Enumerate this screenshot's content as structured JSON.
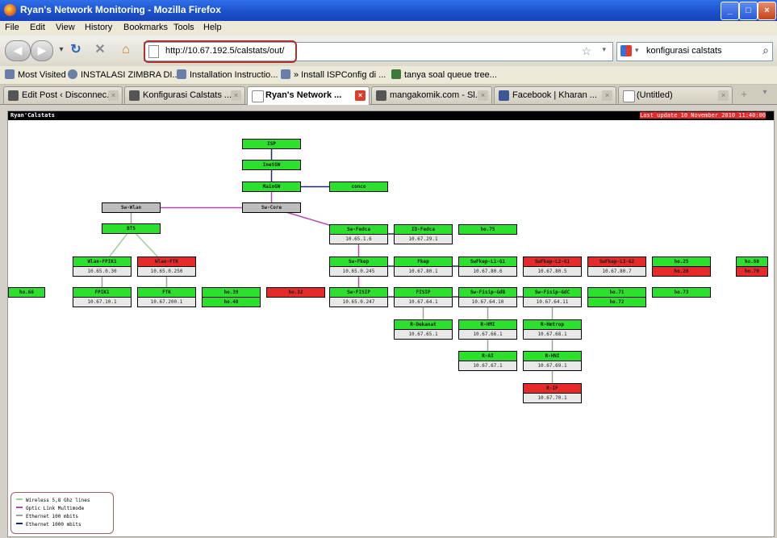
{
  "window": {
    "title": "Ryan's Network Monitoring - Mozilla Firefox"
  },
  "menu": [
    "File",
    "Edit",
    "View",
    "History",
    "Bookmarks",
    "Tools",
    "Help"
  ],
  "address": {
    "url": "http://10.67.192.5/calstats/out/"
  },
  "search": {
    "value": "konfigurasi calstats"
  },
  "bookmarks": [
    "Most Visited",
    "INSTALASI ZIMBRA DI...",
    "Installation Instructio...",
    "» Install ISPConfig di ...",
    "tanya soal queue tree..."
  ],
  "tabs": [
    {
      "label": "Edit Post ‹ Disconnec...",
      "active": false
    },
    {
      "label": "Konfigurasi Calstats ...",
      "active": false
    },
    {
      "label": "Ryan's Network ...",
      "active": true
    },
    {
      "label": "mangakomik.com - Sl...",
      "active": false
    },
    {
      "label": "Facebook | Kharan ...",
      "active": false
    },
    {
      "label": "(Untitled)",
      "active": false
    }
  ],
  "page": {
    "header_left": "Ryan'Calstats",
    "header_right": "Last update 10 November 2010 11:40:00"
  },
  "nodes": [
    {
      "id": "n1",
      "name": "ISP",
      "ip": "",
      "status": "up"
    },
    {
      "id": "n2",
      "name": "InetGW",
      "ip": "",
      "status": "up"
    },
    {
      "id": "n3",
      "name": "MainGW",
      "ip": "",
      "status": "up"
    },
    {
      "id": "n4",
      "name": "conco",
      "ip": "",
      "status": "up"
    },
    {
      "id": "n5",
      "name": "Sw-Wlan",
      "ip": "",
      "status": "switch"
    },
    {
      "id": "n6",
      "name": "Sw-Core",
      "ip": "",
      "status": "switch"
    },
    {
      "id": "n7",
      "name": "BTS",
      "ip": "",
      "status": "up"
    },
    {
      "id": "n8",
      "name": "Sw-Fedca",
      "ip": "10.65.1.6",
      "status": "up"
    },
    {
      "id": "n9",
      "name": "ID-Fedca",
      "ip": "10.67.29.1",
      "status": "up"
    },
    {
      "id": "n10",
      "name": "ho.75",
      "ip": "",
      "status": "up"
    },
    {
      "id": "n11",
      "name": "Wlan-FPIK1",
      "ip": "10.65.0.30",
      "status": "up"
    },
    {
      "id": "n12",
      "name": "Wlan-FTK",
      "ip": "10.65.0.250",
      "status": "down"
    },
    {
      "id": "n13",
      "name": "Sw-Fkep",
      "ip": "10.65.0.245",
      "status": "up"
    },
    {
      "id": "n14",
      "name": "Fkep",
      "ip": "10.67.80.1",
      "status": "up"
    },
    {
      "id": "n15",
      "name": "SwFkep-L1-G1",
      "ip": "10.67.80.6",
      "status": "up"
    },
    {
      "id": "n16",
      "name": "SwFkep-L2-G1",
      "ip": "10.67.80.5",
      "status": "down"
    },
    {
      "id": "n17",
      "name": "SwFkep-L3-G2",
      "ip": "10.67.80.7",
      "status": "down"
    },
    {
      "id": "n18",
      "name": "ho.25",
      "ip": "",
      "status": "up"
    },
    {
      "id": "n19",
      "name": "ho.26",
      "ip": "",
      "status": "down"
    },
    {
      "id": "n20",
      "name": "ho.60",
      "ip": "",
      "status": "up"
    },
    {
      "id": "n21",
      "name": "ho.70",
      "ip": "",
      "status": "down"
    },
    {
      "id": "n22",
      "name": "ho.66",
      "ip": "",
      "status": "up"
    },
    {
      "id": "n23",
      "name": "FPIK1",
      "ip": "10.67.10.1",
      "status": "up"
    },
    {
      "id": "n24",
      "name": "FTK",
      "ip": "10.67.200.1",
      "status": "up"
    },
    {
      "id": "n25",
      "name": "ho.39",
      "ip": "",
      "status": "up"
    },
    {
      "id": "n26",
      "name": "ho.40",
      "ip": "",
      "status": "up"
    },
    {
      "id": "n27",
      "name": "ho.32",
      "ip": "",
      "status": "down"
    },
    {
      "id": "n28",
      "name": "Sw-FISIP",
      "ip": "10.65.0.247",
      "status": "up"
    },
    {
      "id": "n29",
      "name": "FISIP",
      "ip": "10.67.64.1",
      "status": "up"
    },
    {
      "id": "n30",
      "name": "Sw-Fisip-GdB",
      "ip": "10.67.64.10",
      "status": "up"
    },
    {
      "id": "n31",
      "name": "Sw-Fisip-GdC",
      "ip": "10.67.64.11",
      "status": "up"
    },
    {
      "id": "n32",
      "name": "ho.71",
      "ip": "",
      "status": "up"
    },
    {
      "id": "n33",
      "name": "ho.72",
      "ip": "",
      "status": "up"
    },
    {
      "id": "n34",
      "name": "ho.73",
      "ip": "",
      "status": "up"
    },
    {
      "id": "n35",
      "name": "R-Dekanat",
      "ip": "10.67.65.1",
      "status": "up"
    },
    {
      "id": "n36",
      "name": "R-HMI",
      "ip": "10.67.66.1",
      "status": "up"
    },
    {
      "id": "n37",
      "name": "R-Hmtrop",
      "ip": "10.67.68.1",
      "status": "up"
    },
    {
      "id": "n38",
      "name": "R-AI",
      "ip": "10.67.67.1",
      "status": "up"
    },
    {
      "id": "n39",
      "name": "R-HNI",
      "ip": "10.67.69.1",
      "status": "up"
    },
    {
      "id": "n40",
      "name": "R-IF",
      "ip": "10.67.70.1",
      "status": "down"
    }
  ],
  "links": [
    [
      "n1",
      "n2",
      "Ethernet 1000 mbits"
    ],
    [
      "n2",
      "n3",
      "Ethernet 1000 mbits"
    ],
    [
      "n3",
      "n4",
      "Ethernet 1000 mbits"
    ],
    [
      "n3",
      "n6",
      "Optic Link Multimode"
    ],
    [
      "n5",
      "n6",
      "Optic Link Multimode"
    ],
    [
      "n5",
      "n7",
      "Ethernet 100 mbits"
    ],
    [
      "n7",
      "n11",
      "Wireless 5,8 Ghz lines"
    ],
    [
      "n7",
      "n12",
      "Wireless 5,8 Ghz lines"
    ],
    [
      "n11",
      "n23",
      "Ethernet 100 mbits"
    ],
    [
      "n12",
      "n24",
      "Ethernet 100 mbits"
    ],
    [
      "n6",
      "n8",
      "Optic Link Multimode"
    ],
    [
      "n8",
      "n9",
      "Ethernet 1000 mbits"
    ],
    [
      "n8",
      "n13",
      "Optic Link Multimode"
    ],
    [
      "n13",
      "n14",
      "Ethernet 1000 mbits"
    ],
    [
      "n14",
      "n15",
      "Ethernet 1000 mbits"
    ],
    [
      "n13",
      "n28",
      "Optic Link Multimode"
    ],
    [
      "n28",
      "n29",
      "Ethernet 1000 mbits"
    ],
    [
      "n29",
      "n30",
      "Ethernet 1000 mbits"
    ],
    [
      "n30",
      "n31",
      "Ethernet 1000 mbits"
    ],
    [
      "n29",
      "n35",
      "Ethernet 100 mbits"
    ],
    [
      "n30",
      "n36",
      "Ethernet 100 mbits"
    ],
    [
      "n36",
      "n38",
      "Ethernet 100 mbits"
    ],
    [
      "n31",
      "n37",
      "Ethernet 100 mbits"
    ],
    [
      "n37",
      "n39",
      "Ethernet 100 mbits"
    ],
    [
      "n39",
      "n40",
      "Ethernet 100 mbits"
    ]
  ],
  "legend": [
    {
      "label": "Wireless 5,8 Ghz lines",
      "color": "#9ed09e"
    },
    {
      "label": "Optic Link Multimode",
      "color": "#b04ab0"
    },
    {
      "label": "Ethernet 100 mbits",
      "color": "#a0a0a0"
    },
    {
      "label": "Ethernet 1000 mbits",
      "color": "#1a2a6a"
    }
  ]
}
